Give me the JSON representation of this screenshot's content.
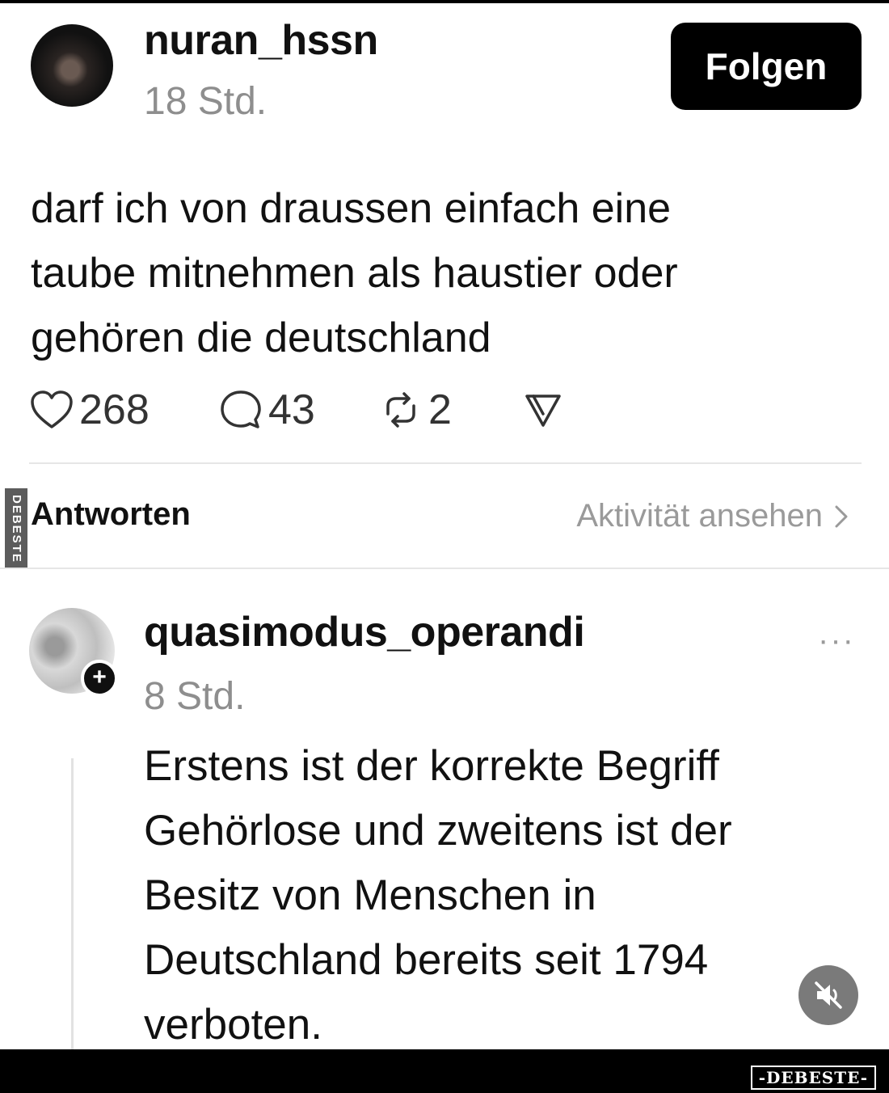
{
  "post": {
    "username": "nuran_hssn",
    "time": "18 Std.",
    "follow_label": "Folgen",
    "text_lines": [
      "darf ich von draussen einfach eine",
      "taube mitnehmen als haustier oder",
      "gehören die deutschland"
    ],
    "likes": "268",
    "comments": "43",
    "reposts": "2"
  },
  "replies_header": {
    "label": "Antworten",
    "activity_link": "Aktivität ansehen"
  },
  "reply": {
    "username": "quasimodus_operandi",
    "time": "8 Std.",
    "more": "···",
    "text_lines": [
      "Erstens ist der korrekte Begriff",
      "Gehörlose und zweitens ist der",
      "Besitz von Menschen in",
      "Deutschland bereits seit 1794",
      "verboten."
    ]
  },
  "watermarks": {
    "side": "DEBESTE",
    "bottom": "-DEBESTE-"
  },
  "icons": [
    "heart-icon",
    "comment-icon",
    "repost-icon",
    "share-icon",
    "chevron-right-icon",
    "mute-icon",
    "plus-icon"
  ]
}
